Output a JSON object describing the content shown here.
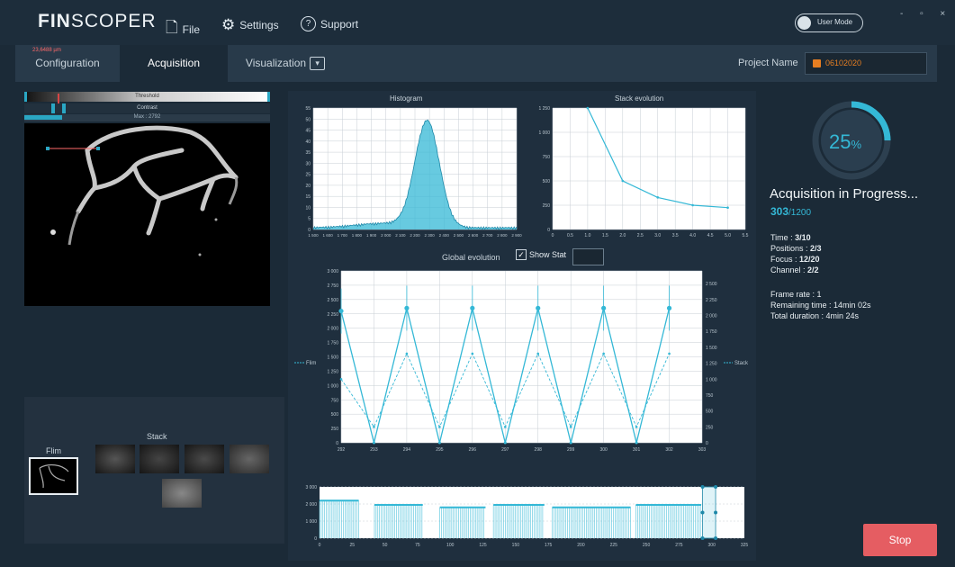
{
  "app": {
    "logo_prefix": "FIN",
    "logo_suffix": "SCOPER"
  },
  "menu": {
    "file": "File",
    "settings": "Settings",
    "support": "Support"
  },
  "usermode_label": "User Mode",
  "window_controls": "-  ▫  ×",
  "tabs": {
    "configuration": "Configuration",
    "acquisition": "Acquisition",
    "visualization": "Visualization",
    "vis_dropdown": "▾"
  },
  "project": {
    "label": "Project Name",
    "value": "06102020"
  },
  "image_panel": {
    "threshold_label": "Threshold",
    "contrast_label": "Contrast",
    "max_label": "Max : 2792",
    "measurement": "23,6488 µm"
  },
  "stack": {
    "stack_label": "Stack",
    "flim_label": "Flim"
  },
  "histogram": {
    "title": "Histogram",
    "ylim": [
      0,
      55
    ],
    "yticks": [
      "0",
      "5",
      "10",
      "15",
      "20",
      "25",
      "30",
      "35",
      "40",
      "45",
      "50",
      "55"
    ],
    "xticks": [
      "1 500",
      "1 600",
      "1 700",
      "1 800",
      "1 900",
      "2 000",
      "2 100",
      "2 200",
      "2 300",
      "2 400",
      "2 500",
      "2 600",
      "2 700",
      "2 800",
      "2 900"
    ]
  },
  "stack_evolution": {
    "title": "Stack evolution",
    "type": "line",
    "x": [
      1,
      2,
      3,
      4,
      5
    ],
    "y": [
      1250,
      500,
      330,
      250,
      225
    ],
    "xlim": [
      0,
      5.5
    ],
    "ylim": [
      0,
      1250
    ],
    "yticks": [
      "0",
      "250",
      "500",
      "750",
      "1 000",
      "1 250"
    ],
    "xticks": [
      "0",
      "0.5",
      "1.0",
      "1.5",
      "2.0",
      "2.5",
      "3.0",
      "3.5",
      "4.0",
      "4.5",
      "5.0",
      "5.5"
    ]
  },
  "global_evolution": {
    "title": "Global evolution",
    "show_stat_label": "Show Stat",
    "show_stat_check": "✓",
    "left_axis_label": "Flim",
    "right_axis_label": "Stack",
    "xticks": [
      "292",
      "293",
      "294",
      "295",
      "296",
      "297",
      "298",
      "299",
      "300",
      "301",
      "302",
      "303"
    ],
    "left_ticks": [
      "0",
      "250",
      "500",
      "750",
      "1 000",
      "1 250",
      "1 500",
      "1 750",
      "2 000",
      "2 250",
      "2 500",
      "2 750",
      "3 000"
    ],
    "right_ticks": [
      "0",
      "250",
      "500",
      "750",
      "1 000",
      "1 250",
      "1 500",
      "1 750",
      "2 000",
      "2 250",
      "2 500"
    ],
    "flim_series": {
      "name": "Flim",
      "x": [
        292,
        293,
        294,
        295,
        296,
        297,
        298,
        299,
        300,
        301,
        302
      ],
      "y": [
        2300,
        0,
        2350,
        0,
        2350,
        0,
        2350,
        0,
        2350,
        0,
        2350
      ]
    },
    "stack_series": {
      "name": "Stack",
      "x": [
        292,
        293,
        294,
        295,
        296,
        297,
        298,
        299,
        300,
        301,
        302
      ],
      "y": [
        1000,
        250,
        1400,
        250,
        1400,
        250,
        1400,
        250,
        1400,
        250,
        1400
      ]
    }
  },
  "mini_chart": {
    "yticks": [
      "0",
      "1 000",
      "2 000",
      "3 000"
    ],
    "xticks": [
      "0",
      "25",
      "50",
      "75",
      "100",
      "125",
      "150",
      "175",
      "200",
      "225",
      "250",
      "275",
      "300",
      "325"
    ]
  },
  "progress": {
    "percent": 25,
    "percent_text": "25",
    "percent_sign": "%",
    "title": "Acquisition in Progress...",
    "done": "303",
    "total": "/1200"
  },
  "info": {
    "time_label": "Time : ",
    "time_value": "3/10",
    "positions_label": "Positions : ",
    "positions_value": "2/3",
    "focus_label": "Focus : ",
    "focus_value": "12/20",
    "channel_label": "Channel : ",
    "channel_value": "2/2",
    "frame_rate": "Frame rate : 1",
    "remaining": "Remaining time : 14min 02s",
    "total_duration": "Total duration : 4min 24s"
  },
  "stop_label": "Stop",
  "colors": {
    "accent": "#34b8d6",
    "stop": "#e55d62",
    "project": "#e67e22"
  }
}
